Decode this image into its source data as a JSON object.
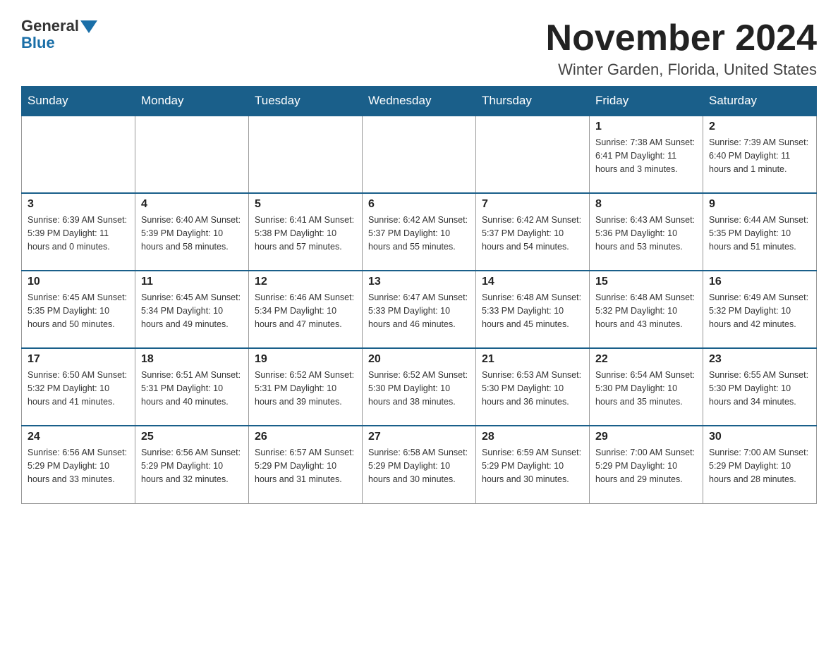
{
  "logo": {
    "general": "General",
    "blue": "Blue"
  },
  "title": "November 2024",
  "subtitle": "Winter Garden, Florida, United States",
  "headers": [
    "Sunday",
    "Monday",
    "Tuesday",
    "Wednesday",
    "Thursday",
    "Friday",
    "Saturday"
  ],
  "weeks": [
    [
      {
        "day": "",
        "info": ""
      },
      {
        "day": "",
        "info": ""
      },
      {
        "day": "",
        "info": ""
      },
      {
        "day": "",
        "info": ""
      },
      {
        "day": "",
        "info": ""
      },
      {
        "day": "1",
        "info": "Sunrise: 7:38 AM\nSunset: 6:41 PM\nDaylight: 11 hours and 3 minutes."
      },
      {
        "day": "2",
        "info": "Sunrise: 7:39 AM\nSunset: 6:40 PM\nDaylight: 11 hours and 1 minute."
      }
    ],
    [
      {
        "day": "3",
        "info": "Sunrise: 6:39 AM\nSunset: 5:39 PM\nDaylight: 11 hours and 0 minutes."
      },
      {
        "day": "4",
        "info": "Sunrise: 6:40 AM\nSunset: 5:39 PM\nDaylight: 10 hours and 58 minutes."
      },
      {
        "day": "5",
        "info": "Sunrise: 6:41 AM\nSunset: 5:38 PM\nDaylight: 10 hours and 57 minutes."
      },
      {
        "day": "6",
        "info": "Sunrise: 6:42 AM\nSunset: 5:37 PM\nDaylight: 10 hours and 55 minutes."
      },
      {
        "day": "7",
        "info": "Sunrise: 6:42 AM\nSunset: 5:37 PM\nDaylight: 10 hours and 54 minutes."
      },
      {
        "day": "8",
        "info": "Sunrise: 6:43 AM\nSunset: 5:36 PM\nDaylight: 10 hours and 53 minutes."
      },
      {
        "day": "9",
        "info": "Sunrise: 6:44 AM\nSunset: 5:35 PM\nDaylight: 10 hours and 51 minutes."
      }
    ],
    [
      {
        "day": "10",
        "info": "Sunrise: 6:45 AM\nSunset: 5:35 PM\nDaylight: 10 hours and 50 minutes."
      },
      {
        "day": "11",
        "info": "Sunrise: 6:45 AM\nSunset: 5:34 PM\nDaylight: 10 hours and 49 minutes."
      },
      {
        "day": "12",
        "info": "Sunrise: 6:46 AM\nSunset: 5:34 PM\nDaylight: 10 hours and 47 minutes."
      },
      {
        "day": "13",
        "info": "Sunrise: 6:47 AM\nSunset: 5:33 PM\nDaylight: 10 hours and 46 minutes."
      },
      {
        "day": "14",
        "info": "Sunrise: 6:48 AM\nSunset: 5:33 PM\nDaylight: 10 hours and 45 minutes."
      },
      {
        "day": "15",
        "info": "Sunrise: 6:48 AM\nSunset: 5:32 PM\nDaylight: 10 hours and 43 minutes."
      },
      {
        "day": "16",
        "info": "Sunrise: 6:49 AM\nSunset: 5:32 PM\nDaylight: 10 hours and 42 minutes."
      }
    ],
    [
      {
        "day": "17",
        "info": "Sunrise: 6:50 AM\nSunset: 5:32 PM\nDaylight: 10 hours and 41 minutes."
      },
      {
        "day": "18",
        "info": "Sunrise: 6:51 AM\nSunset: 5:31 PM\nDaylight: 10 hours and 40 minutes."
      },
      {
        "day": "19",
        "info": "Sunrise: 6:52 AM\nSunset: 5:31 PM\nDaylight: 10 hours and 39 minutes."
      },
      {
        "day": "20",
        "info": "Sunrise: 6:52 AM\nSunset: 5:30 PM\nDaylight: 10 hours and 38 minutes."
      },
      {
        "day": "21",
        "info": "Sunrise: 6:53 AM\nSunset: 5:30 PM\nDaylight: 10 hours and 36 minutes."
      },
      {
        "day": "22",
        "info": "Sunrise: 6:54 AM\nSunset: 5:30 PM\nDaylight: 10 hours and 35 minutes."
      },
      {
        "day": "23",
        "info": "Sunrise: 6:55 AM\nSunset: 5:30 PM\nDaylight: 10 hours and 34 minutes."
      }
    ],
    [
      {
        "day": "24",
        "info": "Sunrise: 6:56 AM\nSunset: 5:29 PM\nDaylight: 10 hours and 33 minutes."
      },
      {
        "day": "25",
        "info": "Sunrise: 6:56 AM\nSunset: 5:29 PM\nDaylight: 10 hours and 32 minutes."
      },
      {
        "day": "26",
        "info": "Sunrise: 6:57 AM\nSunset: 5:29 PM\nDaylight: 10 hours and 31 minutes."
      },
      {
        "day": "27",
        "info": "Sunrise: 6:58 AM\nSunset: 5:29 PM\nDaylight: 10 hours and 30 minutes."
      },
      {
        "day": "28",
        "info": "Sunrise: 6:59 AM\nSunset: 5:29 PM\nDaylight: 10 hours and 30 minutes."
      },
      {
        "day": "29",
        "info": "Sunrise: 7:00 AM\nSunset: 5:29 PM\nDaylight: 10 hours and 29 minutes."
      },
      {
        "day": "30",
        "info": "Sunrise: 7:00 AM\nSunset: 5:29 PM\nDaylight: 10 hours and 28 minutes."
      }
    ]
  ]
}
